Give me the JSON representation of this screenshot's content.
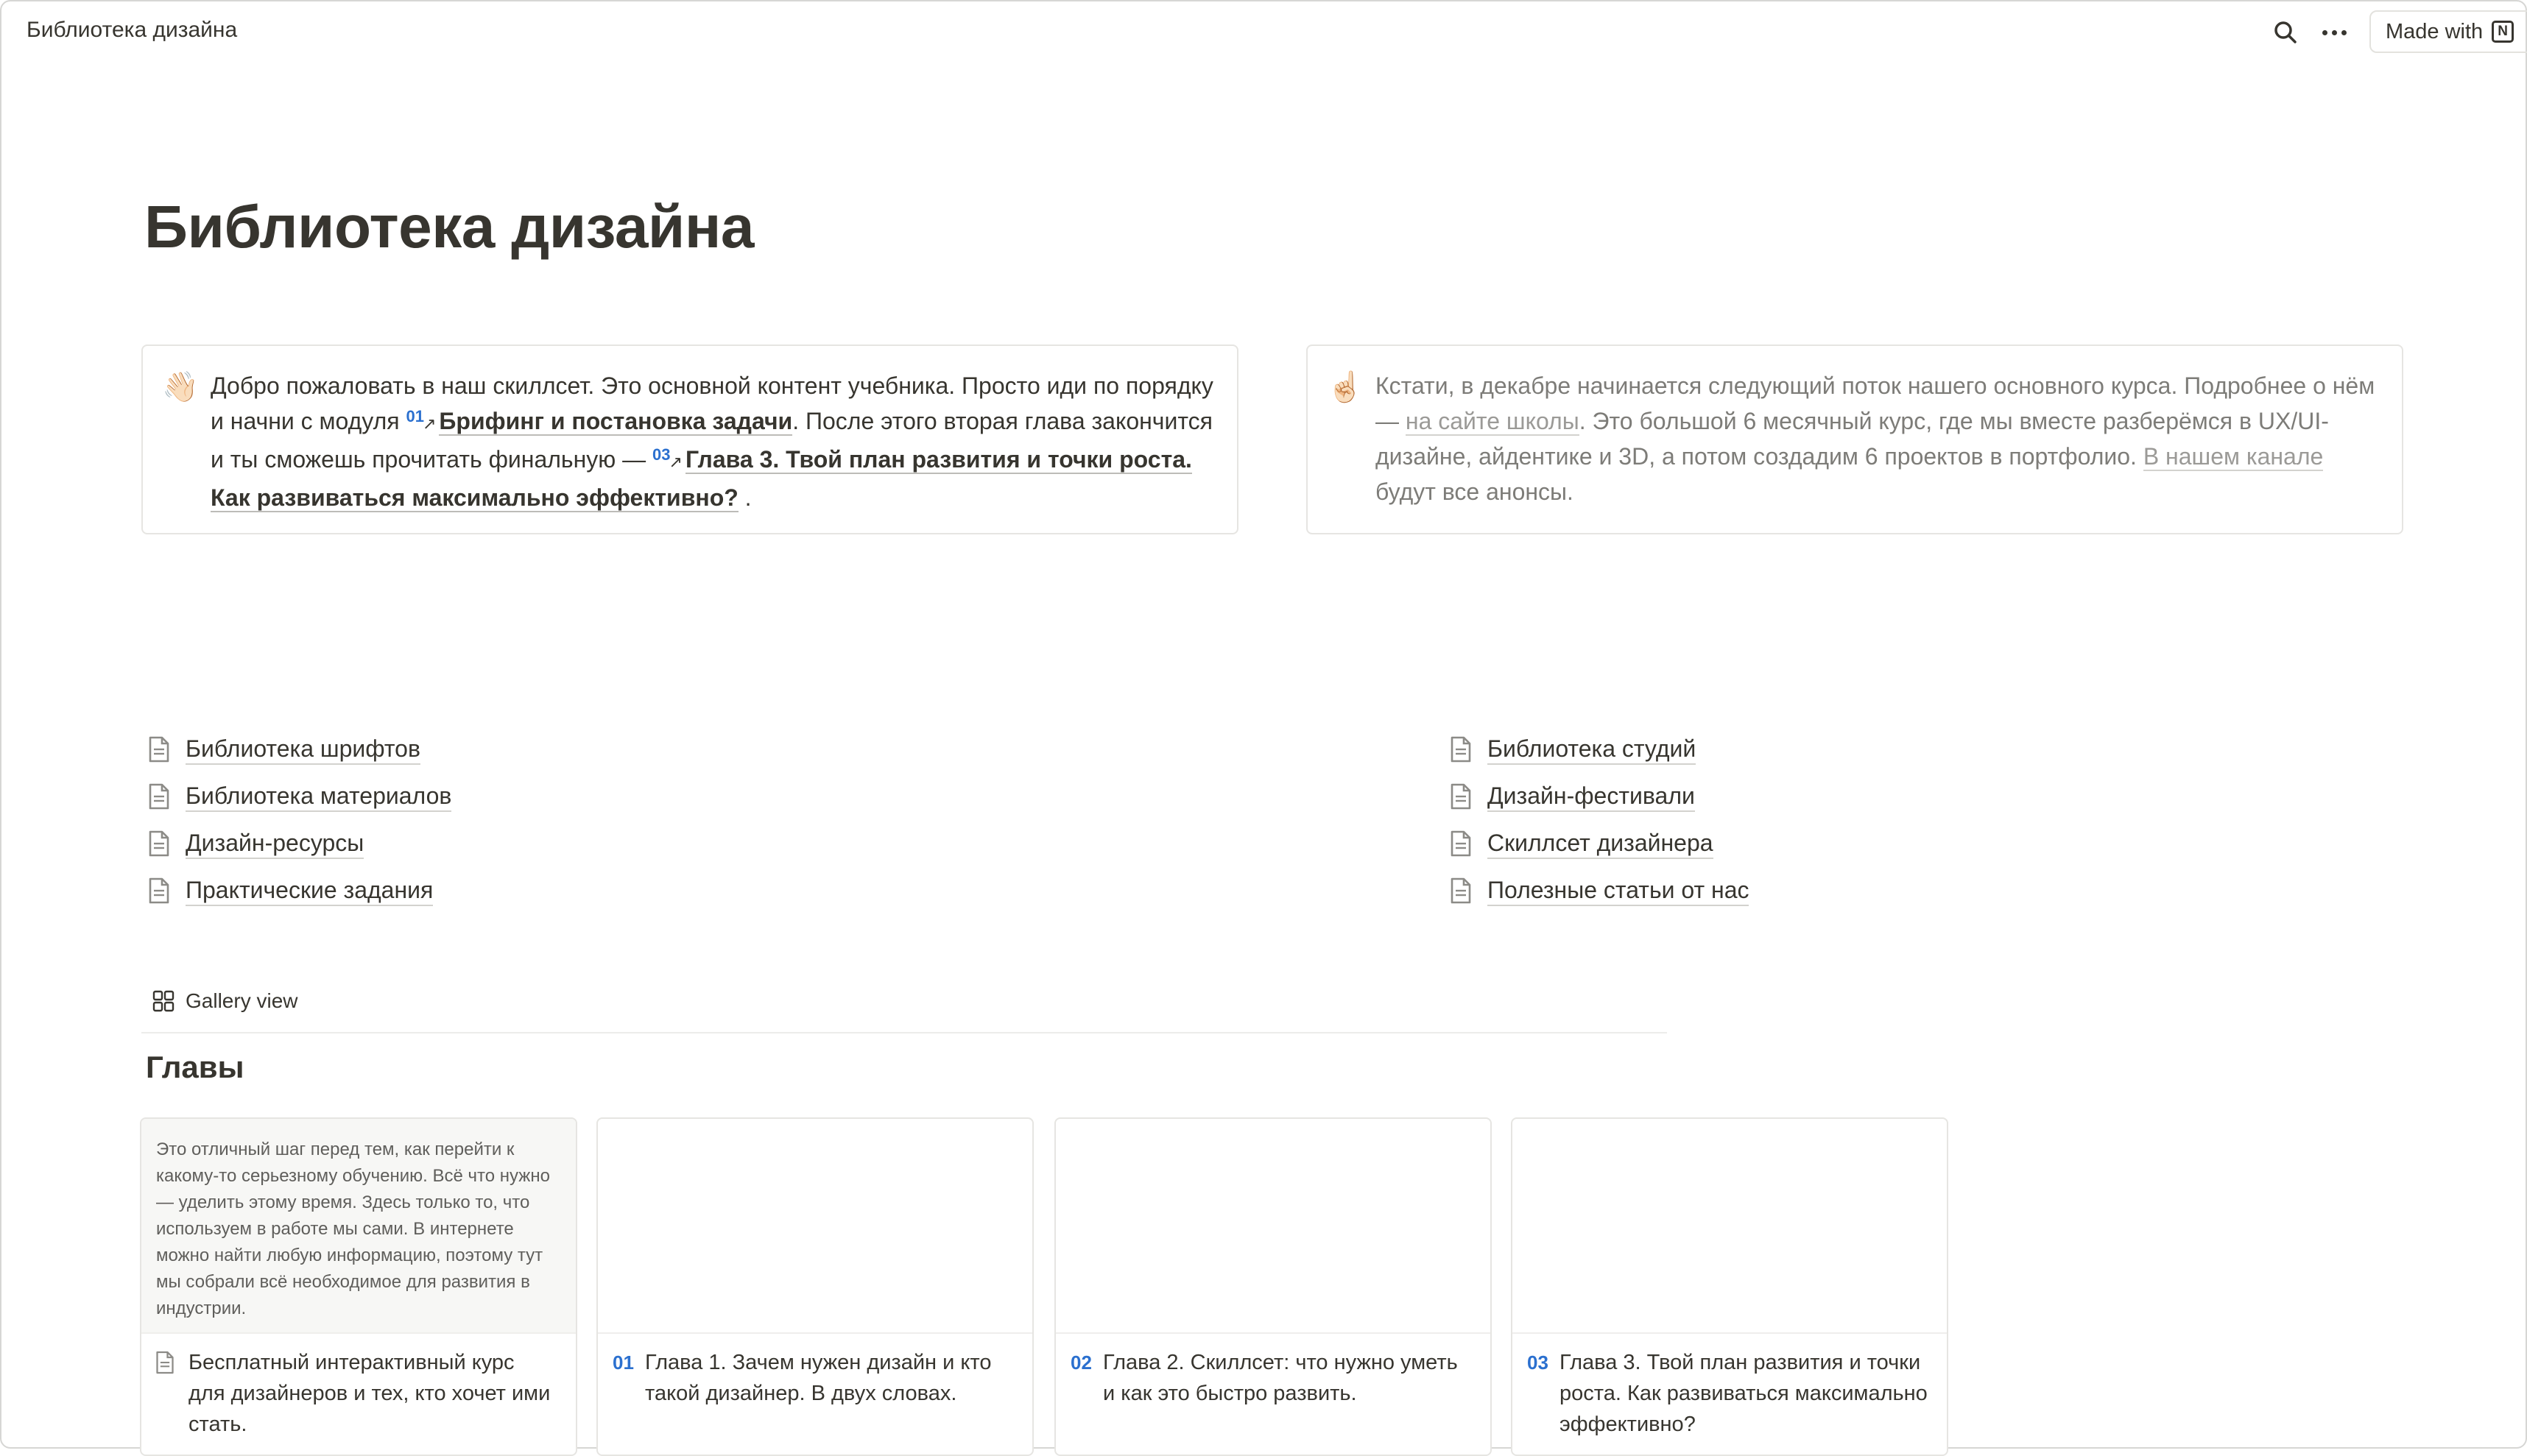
{
  "breadcrumb": "Библиотека дизайна",
  "topbar": {
    "made_with": "Made with",
    "notion_logo": "N"
  },
  "page_title": "Библиотека дизайна",
  "callout_left": {
    "emoji": "👋🏻",
    "t1": "Добро пожаловать в наш скиллсет. Это основной контент учебника. Просто иди по порядку и начни с модуля ",
    "m1_num": "01",
    "m1": "Брифинг и постановка задачи",
    "t2": ". После этого вторая глава закончится и ты сможешь прочитать финальную — ",
    "m2_num": "03",
    "m2": "Глава 3. Твой план развития и точки роста. Как развиваться максимально эффективно?",
    "t3": " ."
  },
  "callout_right": {
    "emoji": "☝🏻",
    "t1": "Кстати, в декабре начинается следующий поток нашего основного курса. Подробнее о нём — ",
    "link1": "на сайте школы",
    "t2": ". Это большой 6 месячный курс, где мы вместе разберёмся в UX/UI-дизайне, айдентике и 3D, а потом создадим 6 проектов в портфолио. ",
    "link2": "В нашем канале",
    "t3": " будут все анонсы."
  },
  "links_left": [
    "Библиотека шрифтов",
    "Библиотека материалов",
    "Дизайн-ресурсы",
    "Практические задания"
  ],
  "links_right": [
    "Библиотека студий",
    "Дизайн-фестивали",
    "Скиллсет дизайнера",
    "Полезные статьи от нас"
  ],
  "gallery": {
    "view_label": "Gallery view",
    "title": "Главы",
    "cards": [
      {
        "badge": "",
        "preview": "Это отличный шаг перед тем, как перейти к какому-то серьезному обучению. Всё что нужно — уделить этому время. Здесь только то, что используем в работе мы сами. В интернете можно найти любую информацию, поэтому тут мы собрали всё необходимое для развития в индустрии.",
        "title": "Бесплатный интерактивный курс для дизайнеров и тех, кто хочет ими стать."
      },
      {
        "badge": "01",
        "preview": "",
        "title": "Глава 1. Зачем нужен дизайн и кто такой дизайнер. В двух словах."
      },
      {
        "badge": "02",
        "preview": "",
        "title": "Глава 2. Скиллсет: что нужно уметь и как это быстро развить."
      },
      {
        "badge": "03",
        "preview": "",
        "title": "Глава 3. Твой план развития и точки роста. Как развиваться максимально эффективно?"
      }
    ]
  },
  "colors": {
    "text": "#37352f",
    "muted": "#7d7c78",
    "accent": "#2b70cf",
    "border": "#e6e5e2"
  },
  "icons": [
    "search-icon",
    "more-icon",
    "notion-logo-icon",
    "page-icon",
    "gallery-view-icon"
  ]
}
